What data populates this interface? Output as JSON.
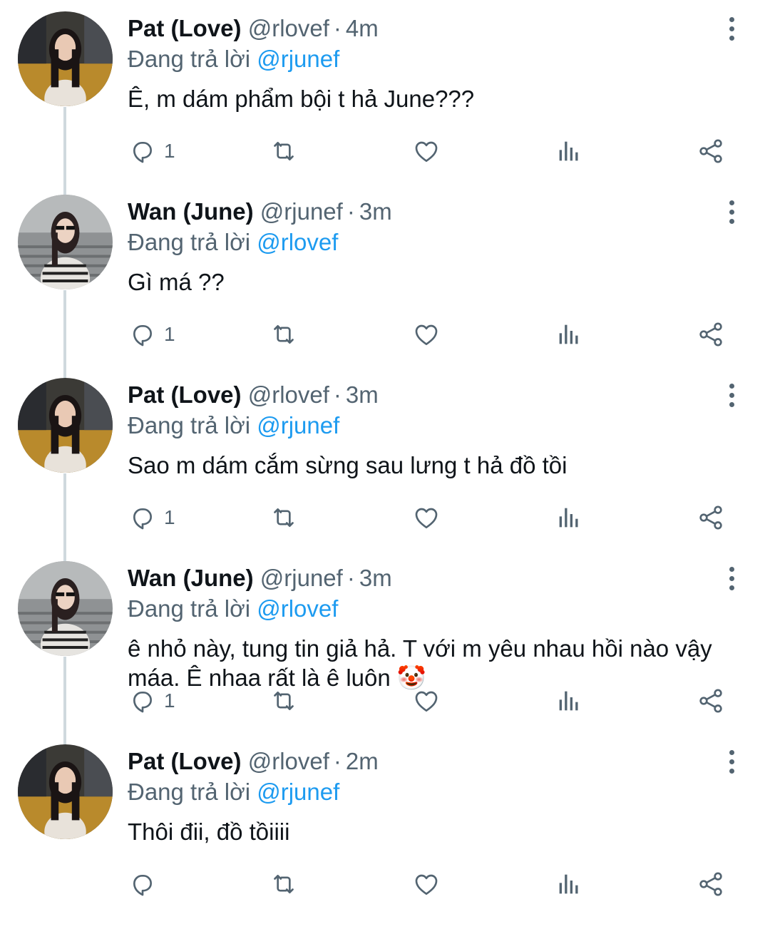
{
  "reply_prefix": "Đang trả lời",
  "tweets": [
    {
      "name": "Pat (Love)",
      "handle": "@rlovef",
      "time": "4m",
      "reply_to": "@rjunef",
      "text": "Ê, m dám phẩm bội t hả June???",
      "reply_count": "1",
      "avatar": "pat"
    },
    {
      "name": "Wan (June)",
      "handle": "@rjunef",
      "time": "3m",
      "reply_to": "@rlovef",
      "text": "Gì má ??",
      "reply_count": "1",
      "avatar": "wan"
    },
    {
      "name": "Pat (Love)",
      "handle": "@rlovef",
      "time": "3m",
      "reply_to": "@rjunef",
      "text": "Sao m dám cắm sừng sau lưng t hả đồ tồi",
      "reply_count": "1",
      "avatar": "pat"
    },
    {
      "name": "Wan (June)",
      "handle": "@rjunef",
      "time": "3m",
      "reply_to": "@rlovef",
      "text": "ê nhỏ này, tung tin giả hả. T với m yêu nhau hồi nào vậy máa. Ê nhaa rất là ê luôn 🤡",
      "reply_count": "1",
      "avatar": "wan"
    },
    {
      "name": "Pat (Love)",
      "handle": "@rlovef",
      "time": "2m",
      "reply_to": "@rjunef",
      "text": "Thôi đii, đồ tồiiii",
      "reply_count": "",
      "avatar": "pat"
    }
  ],
  "icons": {
    "reply": "reply-icon",
    "retweet": "retweet-icon",
    "like": "heart-icon",
    "views": "views-icon",
    "share": "share-icon",
    "more": "more-vertical-icon"
  },
  "colors": {
    "mention": "#1d9bf0",
    "secondary": "#536471",
    "thread_line": "#cfd9de"
  }
}
